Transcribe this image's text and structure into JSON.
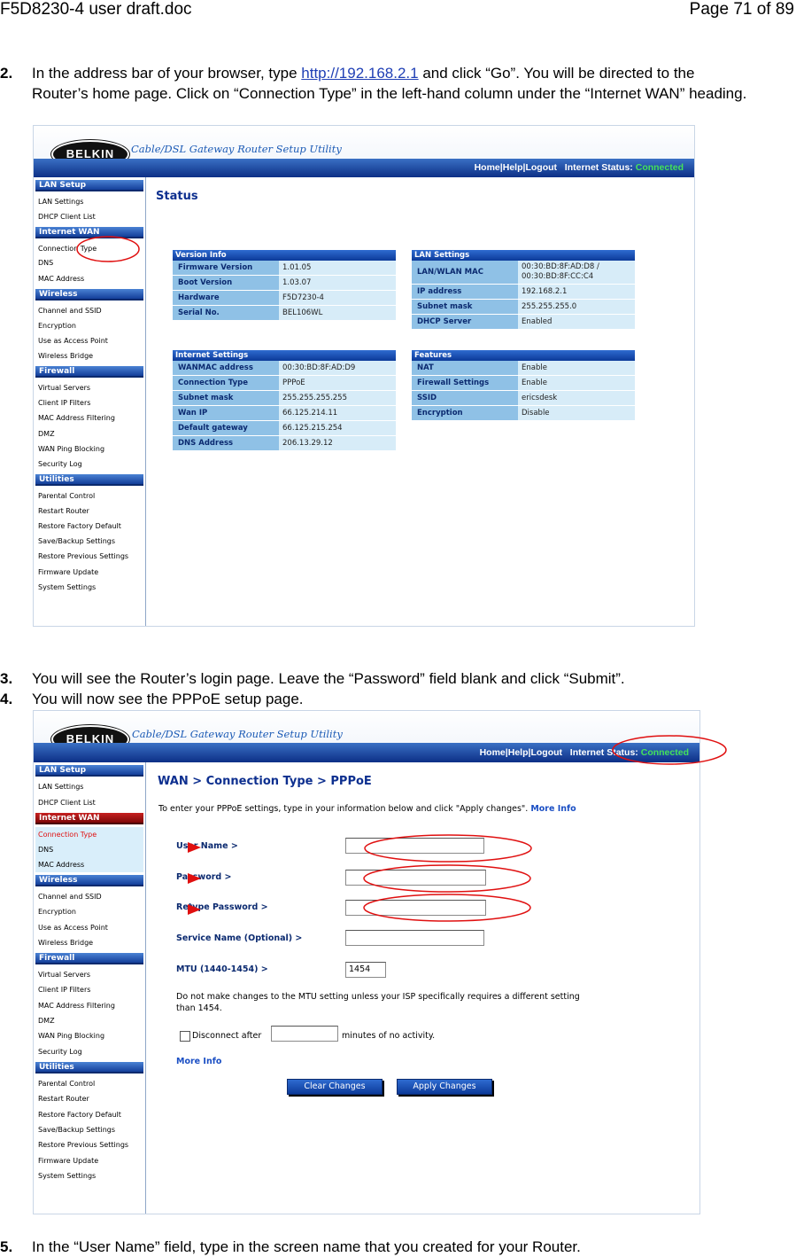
{
  "doc": {
    "filename": "F5D8230-4 user draft.doc",
    "page": "Page 71 of 89"
  },
  "step2": {
    "num": "2.",
    "pre": "In the address bar of your browser, type ",
    "link": "http://192.168.2.1",
    "post": " and click “Go”. You will be directed to the Router’s home page. Click on “Connection Type” in the left-hand column under the “Internet WAN” heading."
  },
  "step3": {
    "num": "3.",
    "text": "You will see the Router’s login page. Leave the “Password” field blank and click “Submit”."
  },
  "step4": {
    "num": "4.",
    "text": "You will now see the PPPoE setup page."
  },
  "step5": {
    "num": "5.",
    "text": "In the “User Name” field, type in the screen name that you created for your Router."
  },
  "router": {
    "logo": "BELKIN",
    "utility_title": "Cable/DSL Gateway Router Setup Utility",
    "nav": {
      "home": "Home",
      "help": "Help",
      "logout": "Logout",
      "status_label": "Internet Status:",
      "status_value": "Connected"
    },
    "sidebar": {
      "lan": {
        "title": "LAN Setup",
        "items": [
          "LAN Settings",
          "DHCP Client List"
        ]
      },
      "wan": {
        "title": "Internet WAN",
        "items": [
          "Connection Type",
          "DNS",
          "MAC Address"
        ]
      },
      "wireless": {
        "title": "Wireless",
        "items": [
          "Channel and SSID",
          "Encryption",
          "Use as Access Point",
          "Wireless Bridge"
        ]
      },
      "firewall": {
        "title": "Firewall",
        "items": [
          "Virtual Servers",
          "Client IP Filters",
          "MAC Address Filtering",
          "DMZ",
          "WAN Ping Blocking",
          "Security Log"
        ]
      },
      "utilities": {
        "title": "Utilities",
        "items": [
          "Parental Control",
          "Restart Router",
          "Restore Factory Default",
          "Save/Backup Settings",
          "Restore Previous Settings",
          "Firmware Update",
          "System Settings"
        ]
      }
    }
  },
  "status_page": {
    "title": "Status",
    "version_info": {
      "title": "Version Info",
      "rows": [
        {
          "k": "Firmware Version",
          "v": "1.01.05"
        },
        {
          "k": "Boot Version",
          "v": "1.03.07"
        },
        {
          "k": "Hardware",
          "v": "F5D7230-4"
        },
        {
          "k": "Serial No.",
          "v": "BEL106WL"
        }
      ]
    },
    "lan_settings": {
      "title": "LAN Settings",
      "rows": [
        {
          "k": "LAN/WLAN MAC",
          "v": "00:30:BD:8F:AD:D8 / 00:30:BD:8F:CC:C4"
        },
        {
          "k": "IP address",
          "v": "192.168.2.1"
        },
        {
          "k": "Subnet mask",
          "v": "255.255.255.0"
        },
        {
          "k": "DHCP Server",
          "v": "Enabled"
        }
      ]
    },
    "internet_settings": {
      "title": "Internet Settings",
      "rows": [
        {
          "k": "WANMAC address",
          "v": "00:30:BD:8F:AD:D9"
        },
        {
          "k": "Connection Type",
          "v": "PPPoE"
        },
        {
          "k": "Subnet mask",
          "v": "255.255.255.255"
        },
        {
          "k": "Wan IP",
          "v": "66.125.214.11"
        },
        {
          "k": "Default gateway",
          "v": "66.125.215.254"
        },
        {
          "k": "DNS Address",
          "v": "206.13.29.12"
        }
      ]
    },
    "features": {
      "title": "Features",
      "rows": [
        {
          "k": "NAT",
          "v": "Enable"
        },
        {
          "k": "Firewall Settings",
          "v": "Enable"
        },
        {
          "k": "SSID",
          "v": "ericsdesk"
        },
        {
          "k": "Encryption",
          "v": "Disable"
        }
      ]
    }
  },
  "pppoe_page": {
    "title": "WAN > Connection Type > PPPoE",
    "intro": "To enter your PPPoE settings, type in your information below and click \"Apply changes\".",
    "more_info": "More Info",
    "fields": {
      "user_name": {
        "label": "User Name >",
        "value": ""
      },
      "password": {
        "label": "Password >",
        "value": ""
      },
      "retype_password": {
        "label": "Retype Password >",
        "value": ""
      },
      "service_name": {
        "label": "Service Name (Optional) >",
        "value": ""
      },
      "mtu": {
        "label": "MTU (1440-1454) >",
        "value": "1454"
      }
    },
    "mtu_note": "Do not make changes to the MTU setting unless your ISP specifically requires a different setting than 1454.",
    "disconnect_pre": "Disconnect after",
    "disconnect_post": "minutes of no activity.",
    "disconnect_value": "",
    "clear_button": "Clear Changes",
    "apply_button": "Apply Changes"
  },
  "colors": {
    "nav_blue": "#0c2f86",
    "link_blue": "#1f3fb5",
    "connected_green": "#44e25a",
    "annotation_red": "#e01010"
  }
}
